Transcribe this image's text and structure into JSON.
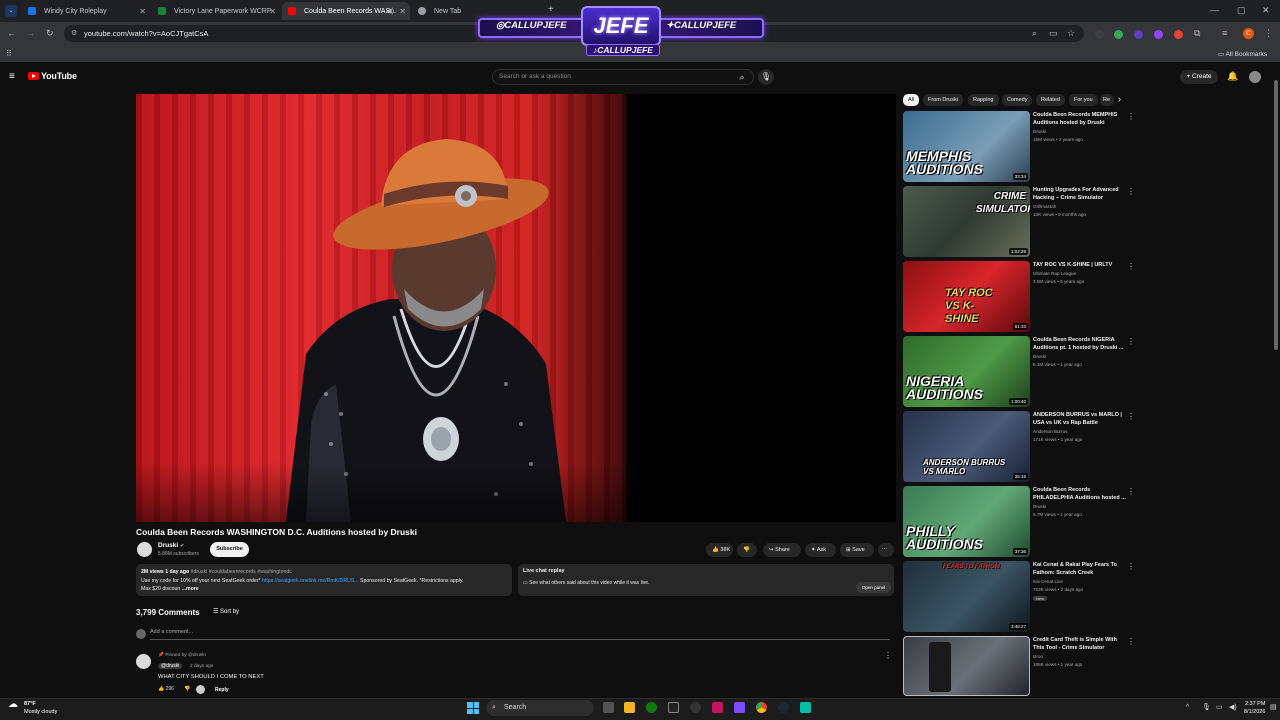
{
  "browser": {
    "tabs": [
      {
        "title": "Windy City Roleplay",
        "color": "#1a73e8"
      },
      {
        "title": "Victory Lane Paperwork WCRP",
        "color": "#188038"
      },
      {
        "title": "Coulda Been Records WAS...",
        "color": "#ff0000"
      },
      {
        "title": "New Tab",
        "color": "#9aa0a6"
      }
    ],
    "new_tab": "+",
    "url": "youtube.com/watch?v=AoCJTgatCsA",
    "all_bookmarks": "All Bookmarks",
    "profile_initial": "C"
  },
  "stream_overlay": {
    "center": "JEFE",
    "handle_left": "CALLUPJEFE",
    "handle_right": "CALLUPJEFE",
    "handle_bottom": "CALLUPJEFE"
  },
  "youtube": {
    "logo": "YouTube",
    "search_placeholder": "Search or ask a question",
    "create": "+ Create"
  },
  "video": {
    "title": "Coulda Been Records WASHINGTON D.C. Auditions hosted by Druski",
    "channel": "Druski",
    "subscribers": "5.88M subscribers",
    "subscribe": "Subscribe",
    "likes": "38K",
    "share": "Share",
    "ask": "Ask",
    "save": "Save",
    "more": "⋯",
    "description": {
      "stats": "2M views  1 day ago",
      "tags": "#druski #couldabeenrecords #washingtondc",
      "line2_a": "Use my code for 10% off your next SeatGeek order* ",
      "line2_link": "https://seatgeek.onelink.me/RmK/DRUS...",
      "line2_b": " Sponsored by SeatGeek. *Restrictions apply.",
      "line3": "Max $20 discoun",
      "more": "...more"
    },
    "live_chat": {
      "title": "Live chat replay",
      "text": "See what others said about this video while it was live.",
      "open_panel": "Open panel"
    }
  },
  "comments": {
    "count": "3,799 Comments",
    "sort": "Sort by",
    "add": "Add a comment...",
    "pinned": "Pinned by @druski",
    "author": "@druski",
    "time": "2 days ago",
    "text": "WHAT CITY SHOULD I COME TO NEXT",
    "likes": "296",
    "reply": "Reply"
  },
  "chips": [
    "All",
    "From Druski",
    "Rapping",
    "Comedy",
    "Related",
    "For you",
    "Re"
  ],
  "recommendations": [
    {
      "title": "Coulda Been Records MEMPHIS Auditions hosted by Druski",
      "channel": "Druski",
      "meta": "15M views • 2 years ago",
      "duration": "33:34",
      "overlay": "MEMPHIS AUDITIONS",
      "bg": "#3b6d8f"
    },
    {
      "title": "Hunting Upgrades For Advanced Hacking – Crime Simulator",
      "channel": "Grillmastah",
      "meta": "13K views • 9 months ago",
      "duration": "1:02:29",
      "overlay": "CRIME SIMULATOR",
      "bg": "#3d4a3e"
    },
    {
      "title": "TAY ROC VS K-SHINE | URLTV",
      "channel": "Ultimate Rap League",
      "meta": "3.5M views • 6 years ago",
      "duration": "51:33",
      "overlay": "TAY ROC VS K-SHINE",
      "bg": "#b3151a"
    },
    {
      "title": "Coulda Been Records NIGERIA Auditions pt. 1 hosted by Druski ...",
      "channel": "Druski",
      "meta": "6.1M views • 1 year ago",
      "duration": "1:00:40",
      "overlay": "NIGERIA AUDITIONS",
      "bg": "#2e6b2b"
    },
    {
      "title": "ANDERSON BURRUS vs MARLO | USA vs UK vs Rap Battle",
      "channel": "Anderson Burrus",
      "meta": "171K views • 1 year ago",
      "duration": "35:16",
      "overlay": "ANDERSON BURRUS VS MARLO",
      "bg": "#27324a"
    },
    {
      "title": "Coulda Been Records PHILADELPHIA Auditions hosted ...",
      "channel": "Druski",
      "meta": "6.7M views • 1 year ago",
      "duration": "37:36",
      "overlay": "PHILLY AUDITIONS",
      "bg": "#3a7a52"
    },
    {
      "title": "Kai Cenat & Rakai Play Fears To Fathom: Scratch Creek",
      "channel": "Kai Cenat Live",
      "meta": "723K views • 2 days ago",
      "duration": "3:48:27",
      "badge": "New",
      "overlay": "FEARS TO FATHOM",
      "bg": "#1f2f3a"
    },
    {
      "title": "Credit Card Theft is Simple With This Tool - Crime Simulator",
      "channel": "Droo",
      "meta": "188K views • 1 year ago",
      "duration": "",
      "overlay": "",
      "bg": "#3a3d42"
    }
  ],
  "taskbar": {
    "temp": "87°F",
    "weather": "Mostly cloudy",
    "search": "Search",
    "time": "2:37 PM",
    "date": "8/1/2026"
  },
  "colors": {
    "accent": "#ff0000",
    "link": "#3ea6ff",
    "overlay_purple": "#8f6bff"
  }
}
